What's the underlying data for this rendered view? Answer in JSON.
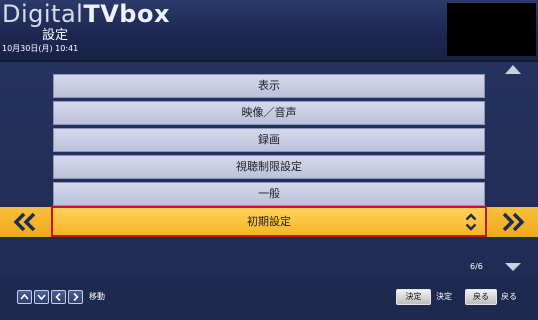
{
  "header": {
    "brand_light": "Digital",
    "brand_bold": "TVbox",
    "screen_title": "設定",
    "datetime": "10月30日(月)  10:41"
  },
  "menu": {
    "items": [
      "表示",
      "映像／音声",
      "録画",
      "視聴制限設定",
      "一般"
    ],
    "selected_label": "初期設定",
    "page_indicator": "6/6"
  },
  "footer": {
    "move_label": "移動",
    "enter_button": "決定",
    "enter_label": "決定",
    "back_button": "戻る",
    "back_label": "戻る"
  },
  "colors": {
    "background": "#23315a",
    "menu_item": "#c9cce3",
    "selected_band": "#f5b52a",
    "selection_border": "#c8151b"
  },
  "icons": [
    "double-chevron-left-icon",
    "double-chevron-right-icon",
    "up-down-arrows-icon",
    "scroll-up-icon",
    "scroll-down-icon",
    "arrow-up-icon",
    "arrow-down-icon",
    "arrow-left-icon",
    "arrow-right-icon"
  ]
}
